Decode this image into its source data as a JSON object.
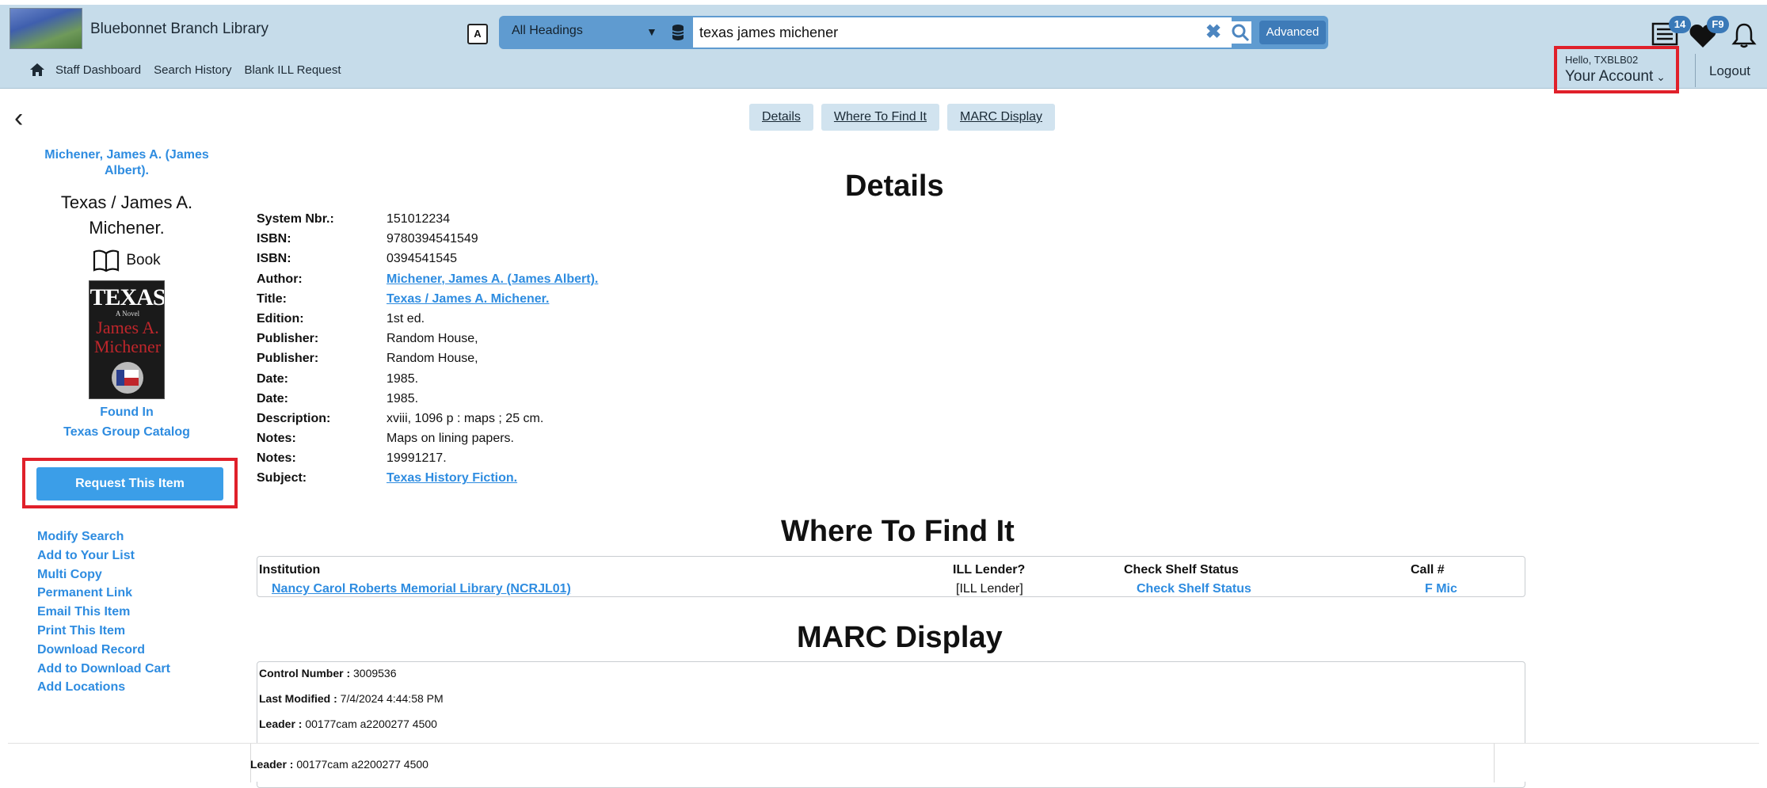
{
  "header": {
    "library_name": "Bluebonnet Branch Library",
    "nav": [
      "Staff Dashboard",
      "Search History",
      "Blank ILL Request"
    ],
    "search": {
      "heading_selected": "All Headings",
      "query": "texas james michener",
      "advanced_label": "Advanced"
    },
    "badges": {
      "list": "14",
      "favorites": "F9"
    },
    "account": {
      "hello": "Hello, TXBLB02",
      "label": "Your Account"
    },
    "logout": "Logout"
  },
  "tabs": [
    "Details",
    "Where To Find It",
    "MARC Display"
  ],
  "left": {
    "author": "Michener, James A. (James Albert).",
    "title": "Texas / James A. Michener.",
    "format": "Book",
    "cover_text": [
      "TEXAS",
      "A Novel",
      "James A.",
      "Michener"
    ],
    "found_in": "Found In",
    "catalog": "Texas Group Catalog",
    "request_button": "Request This Item",
    "actions": [
      "Modify Search",
      "Add to Your List",
      "Multi Copy",
      "Permanent Link",
      "Email This Item",
      "Print This Item",
      "Download Record",
      "Add to Download Cart",
      "Add Locations"
    ]
  },
  "details": {
    "heading": "Details",
    "rows": [
      {
        "label": "System Nbr.:",
        "value": "151012234"
      },
      {
        "label": "ISBN:",
        "value": "9780394541549"
      },
      {
        "label": "ISBN:",
        "value": "0394541545"
      },
      {
        "label": "Author:",
        "value": "Michener, James A. (James Albert).",
        "link": true
      },
      {
        "label": "Title:",
        "value": "Texas / James A. Michener.",
        "link": true
      },
      {
        "label": "Edition:",
        "value": "1st ed."
      },
      {
        "label": "Publisher:",
        "value": "Random House,"
      },
      {
        "label": "Publisher:",
        "value": "Random House,"
      },
      {
        "label": "Date:",
        "value": "1985."
      },
      {
        "label": "Date:",
        "value": "1985."
      },
      {
        "label": "Description:",
        "value": "xviii, 1096 p : maps ; 25 cm."
      },
      {
        "label": "Notes:",
        "value": "Maps on lining papers."
      },
      {
        "label": "Notes:",
        "value": "19991217."
      },
      {
        "label": "Subject:",
        "value": "Texas History Fiction.",
        "link": true
      }
    ]
  },
  "where": {
    "heading": "Where To Find It",
    "columns": [
      "Institution",
      "ILL Lender?",
      "Check Shelf Status",
      "Call #"
    ],
    "row": {
      "institution": "Nancy Carol Roberts Memorial Library (NCRJL01)",
      "ill": "[ILL Lender]",
      "shelf": "Check Shelf Status",
      "call": "F Mic"
    }
  },
  "marc": {
    "heading": "MARC Display",
    "lines": [
      {
        "label": "Control Number :",
        "value": "3009536"
      },
      {
        "label": "Last Modified :",
        "value": "7/4/2024 4:44:58 PM"
      },
      {
        "label": "Leader :",
        "value": "00177cam a2200277 4500"
      }
    ],
    "overlay_line": {
      "label": "Leader :",
      "value": "00177cam a2200277 4500"
    }
  }
}
